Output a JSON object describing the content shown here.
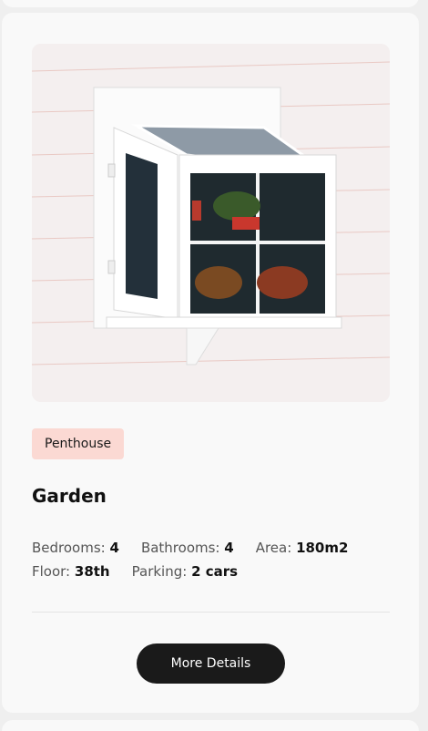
{
  "listing": {
    "category": "Penthouse",
    "title": "Garden",
    "specs": {
      "bedrooms_label": "Bedrooms:",
      "bedrooms": "4",
      "bathrooms_label": "Bathrooms:",
      "bathrooms": "4",
      "area_label": "Area:",
      "area": "180m2",
      "floor_label": "Floor:",
      "floor": "38th",
      "parking_label": "Parking:",
      "parking": "2 cars"
    },
    "button_label": "More Details",
    "image": "garden-window-photo"
  },
  "colors": {
    "card_bg": "#f9f9f9",
    "tag_bg": "#fbd9d3",
    "button_bg": "#1a1a1a"
  }
}
